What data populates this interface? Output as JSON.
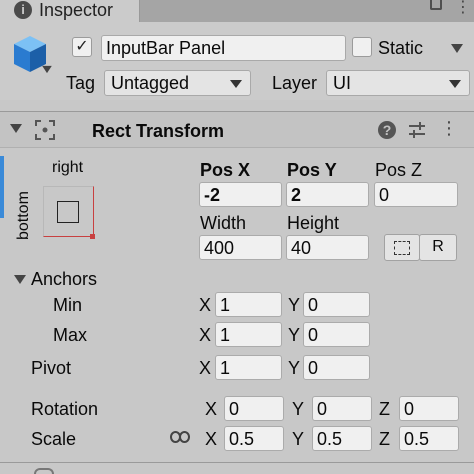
{
  "tab": {
    "title": "Inspector",
    "info_glyph": "i",
    "menu_glyph": "⋮",
    "icons": [
      "info-icon",
      "lock-icon",
      "menu-icon"
    ]
  },
  "header": {
    "object_name": "InputBar Panel",
    "active_check": "✓",
    "static_label": "Static",
    "tag_label": "Tag",
    "tag_value": "Untagged",
    "layer_label": "Layer",
    "layer_value": "UI",
    "icon": "cube-icon"
  },
  "rect_transform": {
    "title": "Rect Transform",
    "help_glyph": "?",
    "icons": [
      "foldout-arrow-icon",
      "rect-transform-icon",
      "help-icon",
      "settings-icon",
      "menu-icon"
    ],
    "anchor_preset": {
      "h_label": "right",
      "v_label": "bottom"
    },
    "pos_x_label": "Pos X",
    "pos_x": "-2",
    "pos_y_label": "Pos Y",
    "pos_y": "2",
    "pos_z_label": "Pos Z",
    "pos_z": "0",
    "width_label": "Width",
    "width": "400",
    "height_label": "Height",
    "height": "40",
    "blueprint_button": "⬚",
    "raw_button": "R",
    "anchors_label": "Anchors",
    "min_label": "Min",
    "min_x": "1",
    "min_y": "0",
    "max_label": "Max",
    "max_x": "1",
    "max_y": "0",
    "pivot_label": "Pivot",
    "pivot_x": "1",
    "pivot_y": "0",
    "rotation_label": "Rotation",
    "rot_x": "0",
    "rot_y": "0",
    "rot_z": "0",
    "scale_label": "Scale",
    "scale_x": "0.5",
    "scale_y": "0.5",
    "scale_z": "0.5",
    "axis_x": "X",
    "axis_y": "Y",
    "axis_z": "Z"
  },
  "colors": {
    "accent_blue": "#3a8ad8",
    "anchor_red": "#c84040",
    "panel_bg": "#c8c8c8"
  }
}
